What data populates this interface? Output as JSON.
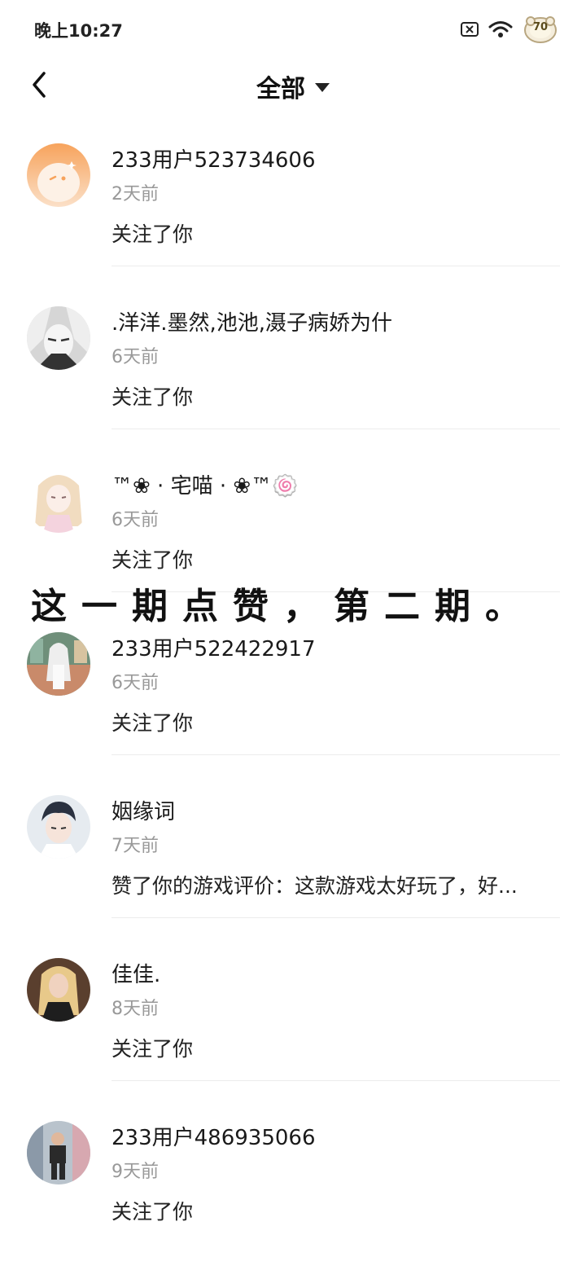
{
  "status_bar": {
    "time": "晚上10:27",
    "battery": "70",
    "icons": [
      "sim-off-icon",
      "wifi-icon",
      "battery-sheep-icon"
    ]
  },
  "header": {
    "back_icon": "chevron-left-icon",
    "title": "全部",
    "dropdown_icon": "caret-down-icon"
  },
  "overlay_caption": "这一期点赞，第二期。",
  "notifications": [
    {
      "name": "233用户523734606",
      "time": "2天前",
      "action": "关注了你",
      "avatar_color": "#f7a35c"
    },
    {
      "name": ".洋洋.墨然,池池,滠子病娇为什",
      "time": "6天前",
      "action": "关注了你",
      "avatar_color": "#bdbdbd"
    },
    {
      "name": "™❀ · 宅喵 · ❀™🍥",
      "time": "6天前",
      "action": "关注了你",
      "avatar_color": "#f3e3ea"
    },
    {
      "name": "233用户522422917",
      "time": "6天前",
      "action": "关注了你",
      "avatar_color": "#c98a6a"
    },
    {
      "name": "姻缘词",
      "time": "7天前",
      "action": "赞了你的游戏评价：这款游戏太好玩了，好...",
      "avatar_color": "#dde3ea"
    },
    {
      "name": "佳佳.",
      "time": "8天前",
      "action": "关注了你",
      "avatar_color": "#6b4a33"
    },
    {
      "name": "233用户486935066",
      "time": "9天前",
      "action": "关注了你",
      "avatar_color": "#7a8a9a"
    }
  ]
}
